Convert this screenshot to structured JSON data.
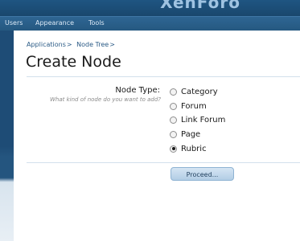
{
  "header": {
    "brand": "XenForo"
  },
  "nav": {
    "tabs": [
      "Users",
      "Appearance",
      "Tools"
    ]
  },
  "breadcrumb": [
    "Applications",
    "Node Tree"
  ],
  "breadcrumb_sep": ">",
  "page": {
    "title": "Create Node"
  },
  "form": {
    "node_type_label": "Node Type:",
    "node_type_hint": "What kind of node do you want to add?",
    "options": [
      "Category",
      "Forum",
      "Link Forum",
      "Page",
      "Rubric"
    ],
    "selected": "Rubric",
    "submit_label": "Proceed..."
  }
}
